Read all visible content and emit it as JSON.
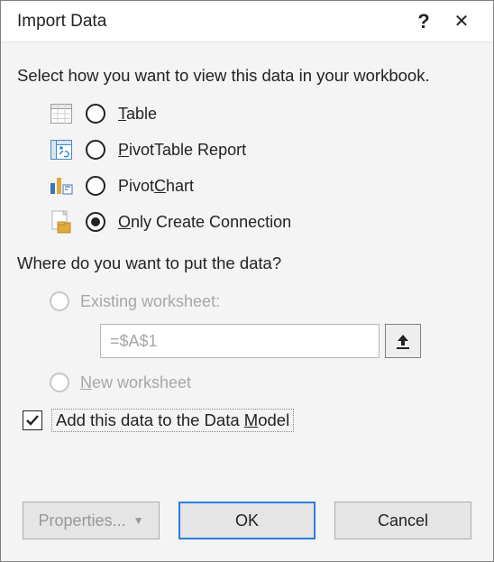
{
  "titlebar": {
    "title": "Import Data",
    "help": "?",
    "close": "✕"
  },
  "section1": {
    "label": "Select how you want to view this data in your workbook.",
    "options": {
      "table": {
        "text_pre": "",
        "key": "T",
        "text_post": "able"
      },
      "pivottable": {
        "text_pre": "",
        "key": "P",
        "text_post": "ivotTable Report"
      },
      "pivotchart": {
        "text_pre": "Pivot",
        "key": "C",
        "text_post": "hart"
      },
      "only": {
        "text_pre": "",
        "key": "O",
        "text_post": "nly Create Connection"
      }
    }
  },
  "section2": {
    "label": "Where do you want to put the data?",
    "existing": {
      "label": "Existing worksheet:"
    },
    "ref_value": "=$A$1",
    "newws": {
      "text_pre": "",
      "key": "N",
      "text_post": "ew worksheet"
    }
  },
  "datamodel": {
    "text_pre": "Add this data to the Data ",
    "key": "M",
    "text_post": "odel"
  },
  "buttons": {
    "properties": "Properties...",
    "ok": "OK",
    "cancel": "Cancel"
  }
}
